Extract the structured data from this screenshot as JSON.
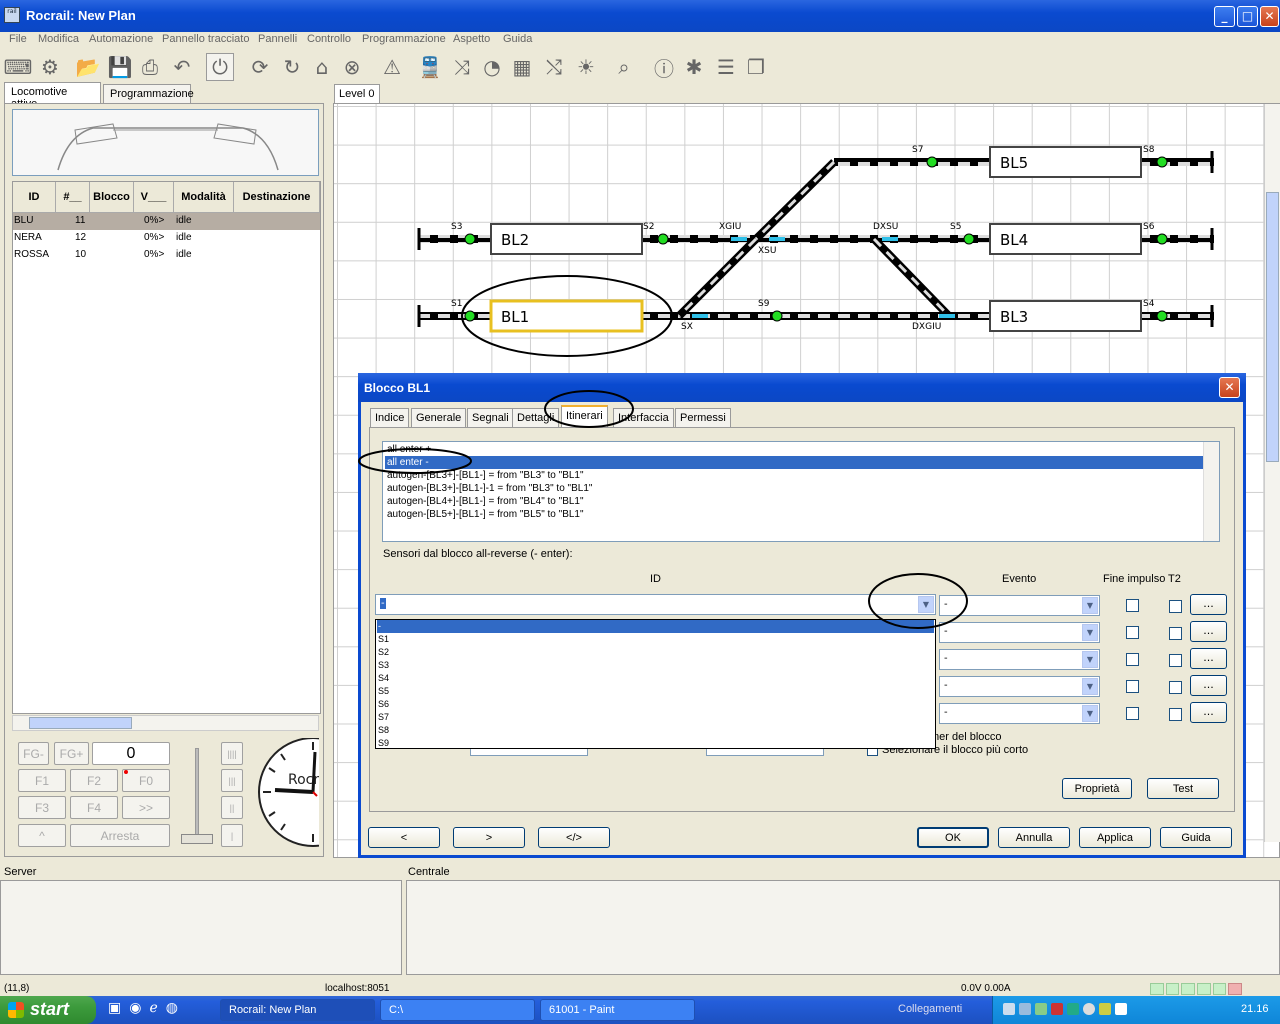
{
  "window": {
    "title": "Rocrail: New Plan"
  },
  "menu": [
    "File",
    "Modifica",
    "Automazione",
    "Pannello tracciato",
    "Pannelli",
    "Controllo",
    "Programmazione",
    "Aspetto",
    "Guida"
  ],
  "left_tabs": {
    "active": "Locomotive attive",
    "other": "Programmazione"
  },
  "loco_table": {
    "headers": [
      "ID",
      "#__",
      "Blocco",
      "V___",
      "Modalità",
      "Destinazione"
    ],
    "rows": [
      {
        "id": "BLU",
        "addr": "11",
        "block": "",
        "v": "0%>",
        "mode": "idle",
        "dest": ""
      },
      {
        "id": "NERA",
        "addr": "12",
        "block": "",
        "v": "0%>",
        "mode": "idle",
        "dest": ""
      },
      {
        "id": "ROSSA",
        "addr": "10",
        "block": "",
        "v": "0%>",
        "mode": "idle",
        "dest": ""
      }
    ]
  },
  "controls": {
    "fg": "FG-",
    "fgplus": "FG+",
    "speed": "0",
    "f1": "F1",
    "f2": "F2",
    "f0": "F0",
    "f3": "F3",
    "f4": "F4",
    "more": ">>",
    "up": "^",
    "stop": "Arresta",
    "v4": "||||",
    "v3": "|||",
    "v2": "||",
    "v1": "|",
    "clock_brand": "Rocr"
  },
  "plan": {
    "tab": "Level 0",
    "blocks": [
      "BL5",
      "BL2",
      "BL4",
      "BL1",
      "BL3"
    ],
    "labels": {
      "s7": "S7",
      "s8": "S8",
      "s3": "S3",
      "s2": "S2",
      "xgiu": "XGIU",
      "dxsu": "DXSU",
      "s5": "S5",
      "s6": "S6",
      "xsu": "XSU",
      "s1": "S1",
      "s9": "S9",
      "s4": "S4",
      "sx": "SX",
      "dxgiu": "DXGIU"
    }
  },
  "dialog": {
    "title": "Blocco BL1",
    "tabs": [
      "Indice",
      "Generale",
      "Segnali",
      "Dettagli",
      "Itinerari",
      "Interfaccia",
      "Permessi"
    ],
    "active_tab": "Itinerari",
    "routes": [
      "all enter +",
      "all enter -",
      "autogen-[BL3+]-[BL1-] = from \"BL3\" to \"BL1\"",
      "autogen-[BL3+]-[BL1-]-1 = from \"BL3\" to \"BL1\"",
      "autogen-[BL4+]-[BL1-] = from \"BL4\" to \"BL1\"",
      "autogen-[BL5+]-[BL1-] = from \"BL5\" to \"BL1\""
    ],
    "selected_route": "all enter -",
    "sensors_label": "Sensori dal blocco all-reverse (- enter):",
    "col_id": "ID",
    "col_event": "Evento",
    "col_fine": "Fine impulso",
    "col_t2": "T2",
    "id_value": "-",
    "event_value": "-",
    "dots": "...",
    "dropdown": [
      "-",
      "S1",
      "S2",
      "S3",
      "S4",
      "S5",
      "S6",
      "S7",
      "S8",
      "S9"
    ],
    "timer_text": "mer del blocco",
    "shortest_text": "Selezionare il blocco più corto",
    "btn_props": "Proprietà",
    "btn_test": "Test",
    "btn_prev": "<",
    "btn_next": ">",
    "btn_xml": "</>",
    "btn_ok": "OK",
    "btn_cancel": "Annulla",
    "btn_apply": "Applica",
    "btn_help": "Guida"
  },
  "bottom": {
    "server": "Server",
    "central": "Centrale"
  },
  "status": {
    "coords": "(11,8)",
    "host": "localhost:8051",
    "power": "0.0V 0.00A"
  },
  "taskbar": {
    "start": "start",
    "tasks": [
      "Rocrail: New Plan",
      "C:\\",
      "61001 - Paint"
    ],
    "links": "Collegamenti",
    "clock": "21.16"
  },
  "colors": {
    "selection": "#316ac5",
    "title": "#0a4ad0",
    "sensor": "#22dd22",
    "track_marker": "#30c0e8",
    "highlight": "#f0c020"
  }
}
